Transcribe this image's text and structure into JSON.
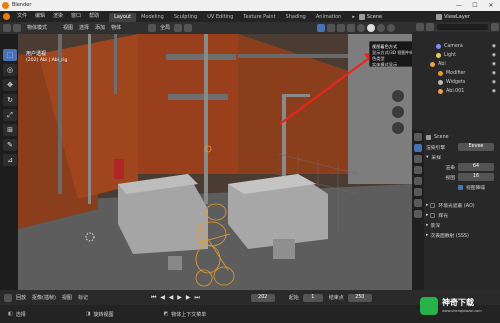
{
  "window": {
    "title": "Blender",
    "minimize": "—",
    "maximize": "☐",
    "close": "✕"
  },
  "menu": {
    "items": [
      "文件",
      "编辑",
      "渲染",
      "窗口",
      "帮助"
    ]
  },
  "workspaces": {
    "tabs": [
      "Layout",
      "Modeling",
      "Sculpting",
      "UV Editing",
      "Texture Paint",
      "Shading",
      "Animation"
    ],
    "active": "Layout"
  },
  "scene": {
    "name": "Scene",
    "view_layer": "ViewLayer"
  },
  "viewport_header": {
    "mode": "物体模式",
    "menus": [
      "视图",
      "选择",
      "添加",
      "物体"
    ],
    "transform": "全局"
  },
  "viewport": {
    "view_name": "用户透视",
    "collection_info": "(202) Abi | Abi_rig"
  },
  "tooltip": {
    "title": "视图着色方式",
    "line1": "显示方式/3D 视图中的物体着色类型",
    "line2": "实体模式显示"
  },
  "outliner": {
    "items": [
      {
        "label": "Camera"
      },
      {
        "label": "Light"
      },
      {
        "label": "Abi"
      },
      {
        "label": "Modifier"
      },
      {
        "label": "Widgets"
      },
      {
        "label": "Abi.001"
      }
    ]
  },
  "properties": {
    "scene_label": "Scene",
    "render_engine_label": "渲染引擎",
    "render_engine_value": "Eevee",
    "sampling_header": "采样",
    "render_label": "渲染",
    "render_value": "64",
    "viewport_label": "视图",
    "viewport_value": "16",
    "denoise_label": "视图降噪",
    "ao_label": "环境光遮蔽 (AO)",
    "bloom_label": "辉光",
    "depth_label": "景深",
    "sss_label": "次表面散射 (SSS)"
  },
  "timeline": {
    "playback": "回放",
    "keying": "抠像(插帧)",
    "view": "视图",
    "marker": "标记",
    "current_frame": "202",
    "start_label": "起始",
    "start_value": "1",
    "end_label": "结束点",
    "end_value": "250"
  },
  "status": {
    "select": "选择",
    "rotate": "旋转视图",
    "context_menu": "物体上下文菜单"
  },
  "watermark": {
    "text": "神奇下载",
    "domain": "www.shenqixiazai.com"
  }
}
